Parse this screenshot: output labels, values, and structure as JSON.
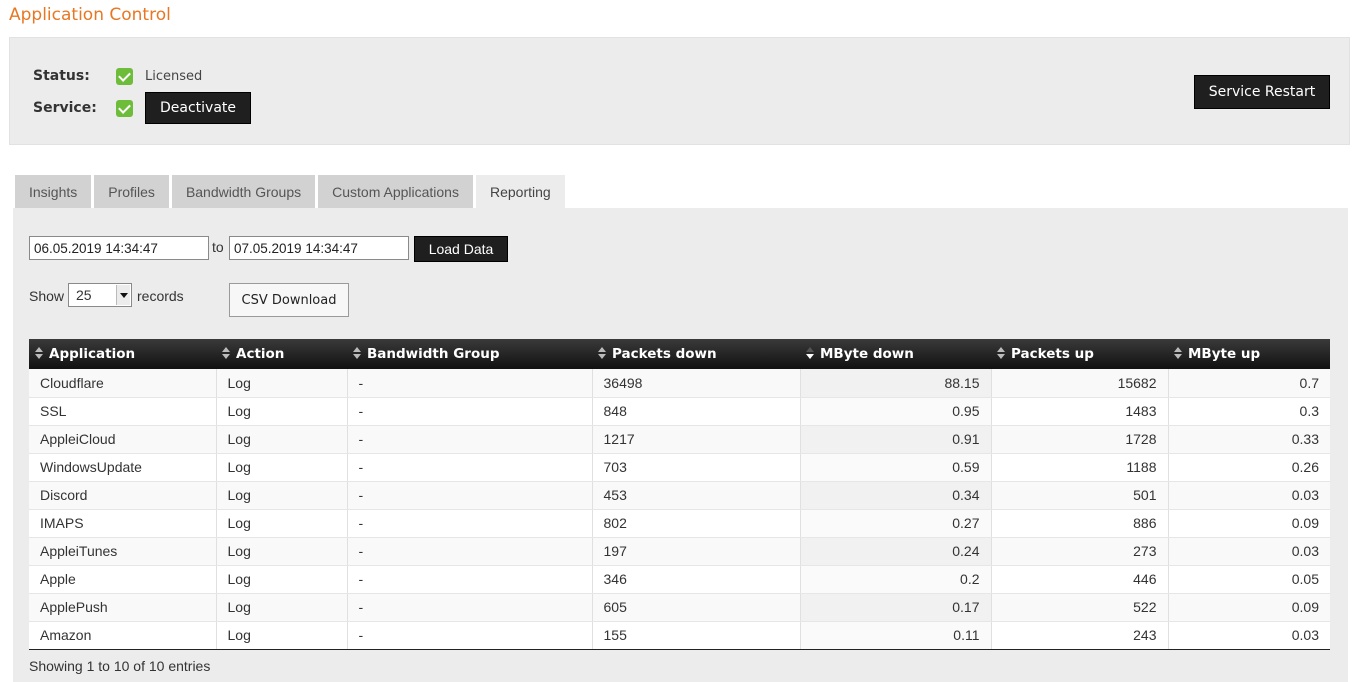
{
  "page": {
    "title": "Application Control"
  },
  "status": {
    "status_label": "Status:",
    "status_value": "Licensed",
    "service_label": "Service:",
    "deactivate_label": "Deactivate",
    "restart_label": "Service Restart"
  },
  "tabs": [
    {
      "label": "Insights",
      "active": false
    },
    {
      "label": "Profiles",
      "active": false
    },
    {
      "label": "Bandwidth Groups",
      "active": false
    },
    {
      "label": "Custom Applications",
      "active": false
    },
    {
      "label": "Reporting",
      "active": true
    }
  ],
  "filter": {
    "from": "06.05.2019 14:34:47",
    "to_label": "to",
    "to": "07.05.2019 14:34:47",
    "load_label": "Load Data",
    "show_label": "Show",
    "page_size": "25",
    "records_label": "records",
    "csv_label": "CSV Download"
  },
  "table": {
    "columns": [
      "Application",
      "Action",
      "Bandwidth Group",
      "Packets down",
      "MByte down",
      "Packets up",
      "MByte up"
    ],
    "sorted_column": 4,
    "rows": [
      [
        "Cloudflare",
        "Log",
        "-",
        "36498",
        "88.15",
        "15682",
        "0.7"
      ],
      [
        "SSL",
        "Log",
        "-",
        "848",
        "0.95",
        "1483",
        "0.3"
      ],
      [
        "AppleiCloud",
        "Log",
        "-",
        "1217",
        "0.91",
        "1728",
        "0.33"
      ],
      [
        "WindowsUpdate",
        "Log",
        "-",
        "703",
        "0.59",
        "1188",
        "0.26"
      ],
      [
        "Discord",
        "Log",
        "-",
        "453",
        "0.34",
        "501",
        "0.03"
      ],
      [
        "IMAPS",
        "Log",
        "-",
        "802",
        "0.27",
        "886",
        "0.09"
      ],
      [
        "AppleiTunes",
        "Log",
        "-",
        "197",
        "0.24",
        "273",
        "0.03"
      ],
      [
        "Apple",
        "Log",
        "-",
        "346",
        "0.2",
        "446",
        "0.05"
      ],
      [
        "ApplePush",
        "Log",
        "-",
        "605",
        "0.17",
        "522",
        "0.09"
      ],
      [
        "Amazon",
        "Log",
        "-",
        "155",
        "0.11",
        "243",
        "0.03"
      ]
    ],
    "info": "Showing 1 to 10 of 10 entries"
  }
}
